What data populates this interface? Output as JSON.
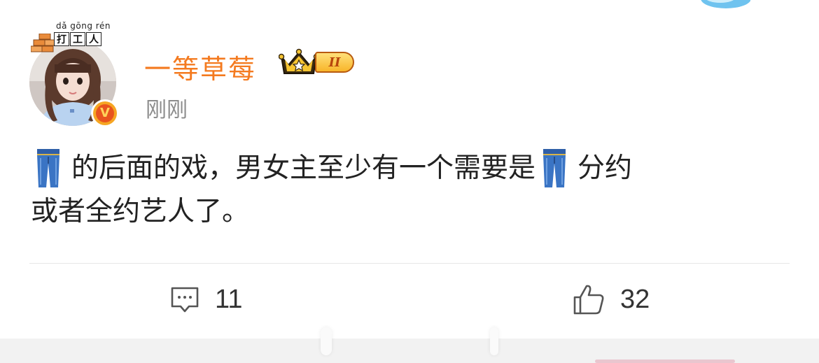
{
  "post": {
    "author": {
      "name": "一等草莓",
      "avatar_title_pinyin": "dǎ gōng rén",
      "avatar_title_chars": [
        "打",
        "工",
        "人"
      ],
      "verified_mark": "V",
      "vip_level": "II"
    },
    "timestamp": "刚刚",
    "body": {
      "line1_part1": "的后面的戏，男女主至少有一个需要是",
      "line1_part2": "分约",
      "line2": "或者全约艺人了。",
      "emoji_name": "jeans-emoji"
    },
    "actions": {
      "comment_count": "11",
      "like_count": "32"
    }
  },
  "colors": {
    "username": "#f47a1f",
    "timestamp": "#8c8c8c",
    "body_text": "#222222",
    "divider": "#e6e6e6"
  },
  "icons": {
    "comment": "comment-icon",
    "like": "thumbs-up-icon",
    "crown": "crown-icon",
    "verified": "verified-v-icon"
  }
}
